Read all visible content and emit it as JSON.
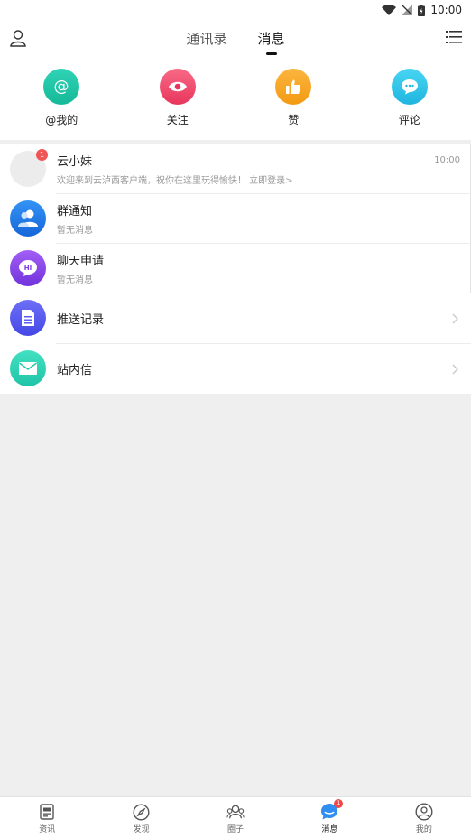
{
  "status_bar": {
    "time": "10:00",
    "icons": [
      "wifi-icon",
      "no-signal-icon",
      "battery-icon"
    ]
  },
  "header": {
    "tabs": [
      {
        "label": "通讯录",
        "active": false
      },
      {
        "label": "消息",
        "active": true
      }
    ],
    "left_icon": "user-icon",
    "right_icon": "menu-list-icon"
  },
  "quick_actions": [
    {
      "label": "@我的",
      "icon": "at-icon",
      "color": "#1fc3a5"
    },
    {
      "label": "关注",
      "icon": "eye-icon",
      "color": "#f0466b"
    },
    {
      "label": "赞",
      "icon": "thumbs-up-icon",
      "color": "#f5a623"
    },
    {
      "label": "评论",
      "icon": "comment-icon",
      "color": "#2ec6e8"
    }
  ],
  "messages": [
    {
      "title": "云小妹",
      "subtitle": "欢迎来到云泸西客户端，祝你在这里玩得愉快！ 立即登录>",
      "time": "10:00",
      "badge": "1",
      "icon": "default-avatar"
    },
    {
      "title": "群通知",
      "subtitle": "暂无消息",
      "icon": "group-icon",
      "color": "#1f7ee8"
    },
    {
      "title": "聊天申请",
      "subtitle": "暂无消息",
      "icon": "chat-hi-icon",
      "color": "#8a45e6"
    },
    {
      "title": "推送记录",
      "icon": "document-icon",
      "color": "#5a5cf0"
    },
    {
      "title": "站内信",
      "icon": "mail-icon",
      "color": "#2fd3b5"
    }
  ],
  "bottom_nav": [
    {
      "label": "资讯",
      "icon": "news-icon",
      "active": false
    },
    {
      "label": "发现",
      "icon": "compass-icon",
      "active": false
    },
    {
      "label": "圈子",
      "icon": "circle-group-icon",
      "active": false
    },
    {
      "label": "消息",
      "icon": "message-icon",
      "active": true,
      "badge": "1"
    },
    {
      "label": "我的",
      "icon": "profile-icon",
      "active": false
    }
  ]
}
